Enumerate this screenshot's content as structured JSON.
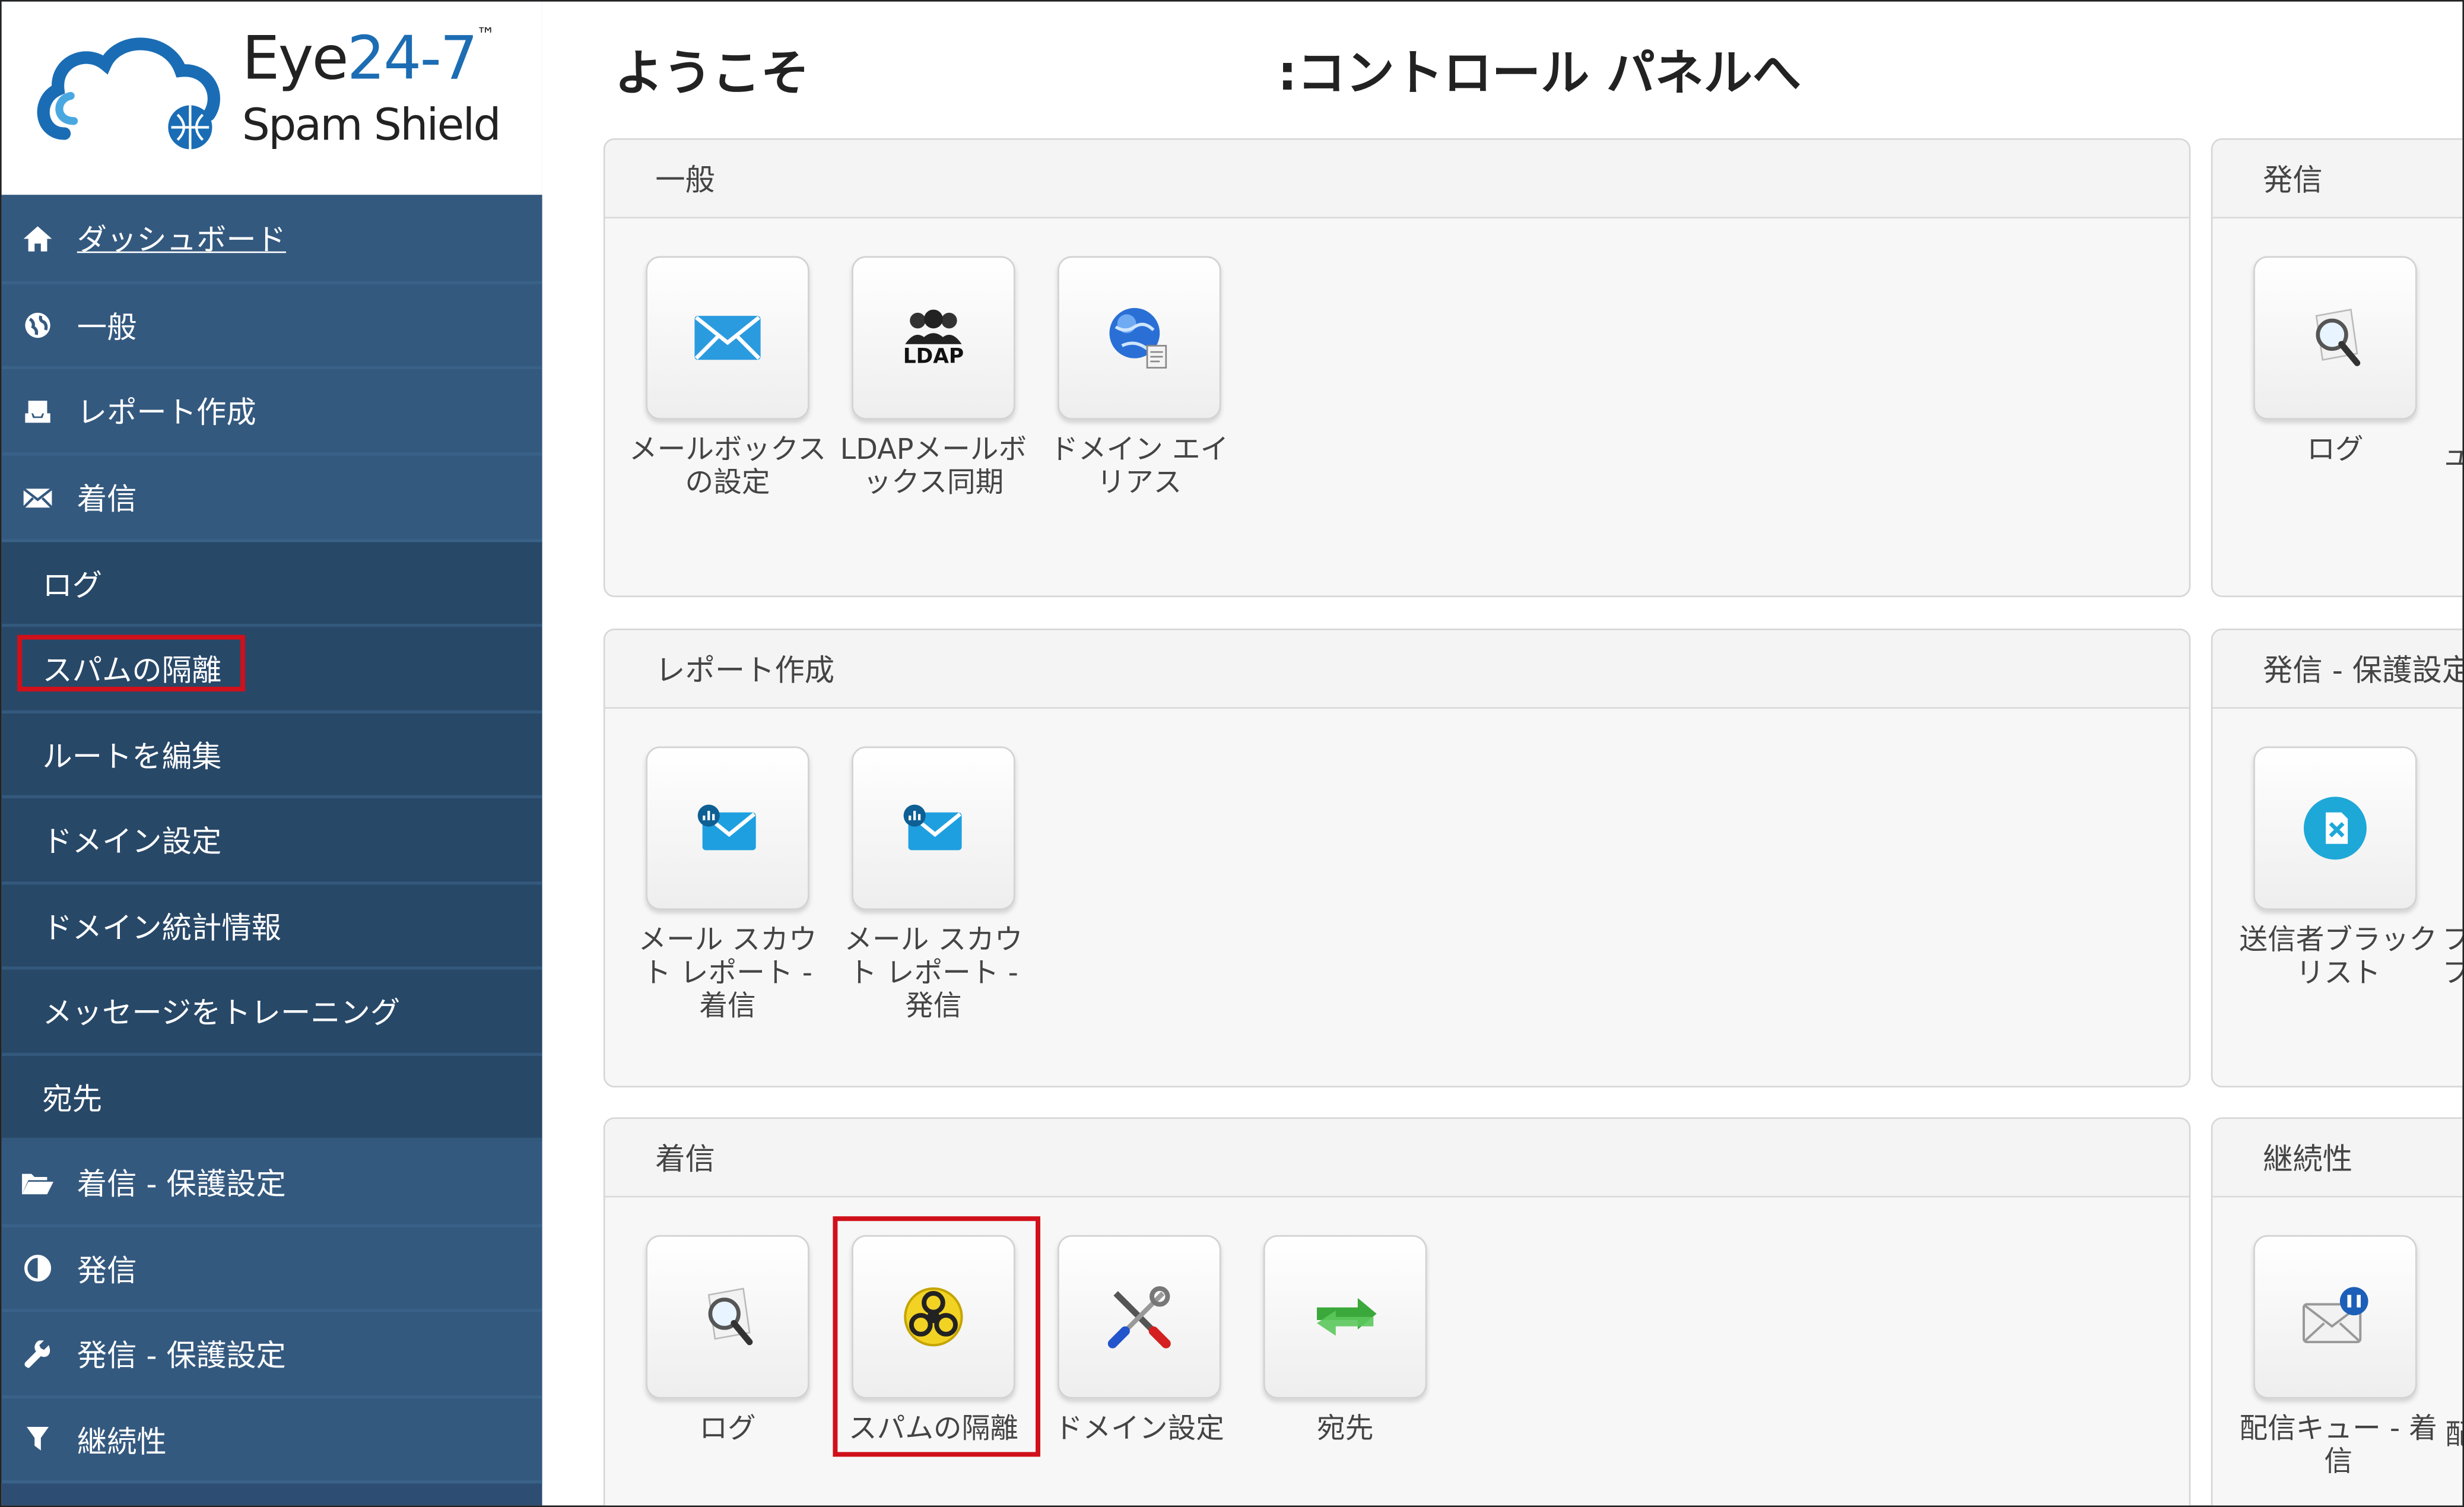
{
  "logo": {
    "brand_line1_prefix": "Eye",
    "brand_line1_number": "24-7",
    "brand_line1_tm": "™",
    "brand_line2": "Spam Shield"
  },
  "sidebar": {
    "items": [
      {
        "label": "ダッシュボード",
        "icon": "home-icon"
      },
      {
        "label": "一般",
        "icon": "globe-icon"
      },
      {
        "label": "レポート作成",
        "icon": "inbox-icon"
      },
      {
        "label": "着信",
        "icon": "envelope-icon"
      },
      {
        "label": "ログ"
      },
      {
        "label": "スパムの隔離"
      },
      {
        "label": "ルートを編集"
      },
      {
        "label": "ドメイン設定"
      },
      {
        "label": "ドメイン統計情報"
      },
      {
        "label": "メッセージをトレーニング"
      },
      {
        "label": "宛先"
      },
      {
        "label": "着信 - 保護設定",
        "icon": "folder-open-icon"
      },
      {
        "label": "発信",
        "icon": "half-circle-icon"
      },
      {
        "label": "発信 - 保護設定",
        "icon": "wrench-icon"
      },
      {
        "label": "継続性",
        "icon": "filter-icon"
      }
    ]
  },
  "header": {
    "title_part1": "ようこそ",
    "title_part2": ":コントロール パネルへ"
  },
  "panels": {
    "general": {
      "title": "一般",
      "tiles": [
        {
          "line1": "メールボックス",
          "line2": "の設定",
          "icon": "mail-icon"
        },
        {
          "line1": "LDAPメールボ",
          "line2": "ックス同期",
          "icon": "ldap-users-icon",
          "icon_text": "LDAP"
        },
        {
          "line1": "ドメイン エイ",
          "line2": "リアス",
          "icon": "globe-document-icon"
        }
      ]
    },
    "reporting": {
      "title": "レポート作成",
      "tiles": [
        {
          "line1": "メール スカウ",
          "line2": "ト レポート -",
          "line3": "着信",
          "icon": "mail-report-icon"
        },
        {
          "line1": "メール スカウ",
          "line2": "ト レポート -",
          "line3": "発信",
          "icon": "mail-report-icon"
        }
      ]
    },
    "inbound": {
      "title": "着信",
      "tiles": [
        {
          "line1": "ログ",
          "icon": "magnifier-icon"
        },
        {
          "line1": "スパムの隔離",
          "icon": "biohazard-icon"
        },
        {
          "line1": "ドメイン設定",
          "icon": "tools-icon"
        },
        {
          "line1": "宛先",
          "icon": "arrows-icon"
        }
      ]
    },
    "outbound": {
      "title": "発信",
      "tiles": [
        {
          "line1": "ログ",
          "icon": "magnifier-icon"
        }
      ],
      "cut_text": "ュ"
    },
    "outbound_protection": {
      "title": "発信 - 保護設定",
      "tiles": [
        {
          "line1": "送信者ブラック",
          "line2": "リスト",
          "icon": "blacklist-icon"
        }
      ],
      "cut_text1": "フ",
      "cut_text2": "フ"
    },
    "continuity": {
      "title": "継続性",
      "tiles": [
        {
          "line1": "配信キュー - 着",
          "line2": "信",
          "icon": "mail-queue-icon"
        }
      ],
      "cut_text": "配"
    }
  },
  "colors": {
    "sidebar_bg": "#34597f",
    "sidebar_sub_bg": "#284868",
    "highlight": "#d0101a",
    "brand_blue": "#1c6db3"
  }
}
